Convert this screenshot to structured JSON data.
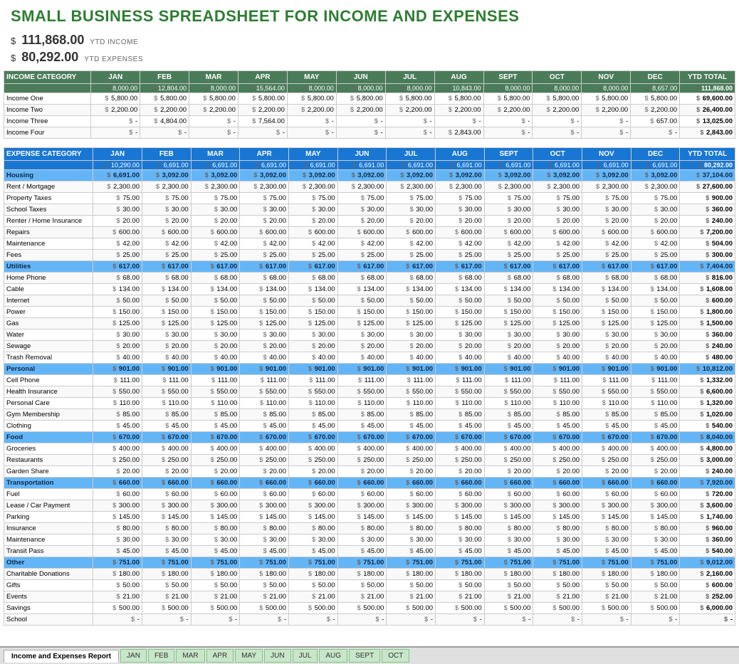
{
  "title": "SMALL BUSINESS SPREADSHEET FOR INCOME AND EXPENSES",
  "ytd_income_label": "YTD INCOME",
  "ytd_income_value": "111,868.00",
  "ytd_expenses_label": "YTD EXPENSES",
  "ytd_expenses_value": "80,292.00",
  "income_table": {
    "category_header": "INCOME CATEGORY",
    "columns": [
      "JAN",
      "FEB",
      "MAR",
      "APR",
      "MAY",
      "JUN",
      "JUL",
      "AUG",
      "SEPT",
      "OCT",
      "NOV",
      "DEC",
      "YTD TOTAL"
    ],
    "totals_row": [
      "8,000.00",
      "12,804.00",
      "8,000.00",
      "15,564.00",
      "8,000.00",
      "8,000.00",
      "8,000.00",
      "10,843.00",
      "8,000.00",
      "8,000.00",
      "8,000.00",
      "8,657.00",
      "111,868.00"
    ],
    "rows": [
      {
        "name": "Income One",
        "values": [
          "5,800.00",
          "5,800.00",
          "5,800.00",
          "5,800.00",
          "5,800.00",
          "5,800.00",
          "5,800.00",
          "5,800.00",
          "5,800.00",
          "5,800.00",
          "5,800.00",
          "5,800.00",
          "69,600.00"
        ]
      },
      {
        "name": "Income Two",
        "values": [
          "2,200.00",
          "2,200.00",
          "2,200.00",
          "2,200.00",
          "2,200.00",
          "2,200.00",
          "2,200.00",
          "2,200.00",
          "2,200.00",
          "2,200.00",
          "2,200.00",
          "2,200.00",
          "26,400.00"
        ]
      },
      {
        "name": "Income Three",
        "values": [
          "-",
          "4,804.00",
          "-",
          "7,564.00",
          "-",
          "-",
          "-",
          "-",
          "-",
          "-",
          "-",
          "657.00",
          "13,025.00"
        ]
      },
      {
        "name": "Income Four",
        "values": [
          "-",
          "-",
          "-",
          "-",
          "-",
          "-",
          "-",
          "2,843.00",
          "-",
          "-",
          "-",
          "-",
          "2,843.00"
        ]
      }
    ]
  },
  "expense_table": {
    "category_header": "EXPENSE CATEGORY",
    "columns": [
      "JAN",
      "FEB",
      "MAR",
      "APR",
      "MAY",
      "JUN",
      "JUL",
      "AUG",
      "SEPT",
      "OCT",
      "NOV",
      "DEC",
      "YTD TOTAL"
    ],
    "totals_row": [
      "10,290.00",
      "6,691.00",
      "6,691.00",
      "6,691.00",
      "6,691.00",
      "6,691.00",
      "6,691.00",
      "6,691.00",
      "6,691.00",
      "6,691.00",
      "6,691.00",
      "6,691.00",
      "80,292.00"
    ],
    "sections": [
      {
        "name": "Housing",
        "total": [
          "6,691.00",
          "3,092.00",
          "3,092.00",
          "3,092.00",
          "3,092.00",
          "3,092.00",
          "3,092.00",
          "3,092.00",
          "3,092.00",
          "3,092.00",
          "3,092.00",
          "3,092.00",
          "37,104.00"
        ],
        "rows": [
          {
            "name": "Rent / Mortgage",
            "values": [
              "2,300.00",
              "2,300.00",
              "2,300.00",
              "2,300.00",
              "2,300.00",
              "2,300.00",
              "2,300.00",
              "2,300.00",
              "2,300.00",
              "2,300.00",
              "2,300.00",
              "2,300.00",
              "27,600.00"
            ]
          },
          {
            "name": "Property Taxes",
            "values": [
              "75.00",
              "75.00",
              "75.00",
              "75.00",
              "75.00",
              "75.00",
              "75.00",
              "75.00",
              "75.00",
              "75.00",
              "75.00",
              "75.00",
              "900.00"
            ]
          },
          {
            "name": "School Taxes",
            "values": [
              "30.00",
              "30.00",
              "30.00",
              "30.00",
              "30.00",
              "30.00",
              "30.00",
              "30.00",
              "30.00",
              "30.00",
              "30.00",
              "30.00",
              "360.00"
            ]
          },
          {
            "name": "Renter / Home Insurance",
            "values": [
              "20.00",
              "20.00",
              "20.00",
              "20.00",
              "20.00",
              "20.00",
              "20.00",
              "20.00",
              "20.00",
              "20.00",
              "20.00",
              "20.00",
              "240.00"
            ]
          },
          {
            "name": "Repairs",
            "values": [
              "600.00",
              "600.00",
              "600.00",
              "600.00",
              "600.00",
              "600.00",
              "600.00",
              "600.00",
              "600.00",
              "600.00",
              "600.00",
              "600.00",
              "7,200.00"
            ]
          },
          {
            "name": "Maintenance",
            "values": [
              "42.00",
              "42.00",
              "42.00",
              "42.00",
              "42.00",
              "42.00",
              "42.00",
              "42.00",
              "42.00",
              "42.00",
              "42.00",
              "42.00",
              "504.00"
            ]
          },
          {
            "name": "Fees",
            "values": [
              "25.00",
              "25.00",
              "25.00",
              "25.00",
              "25.00",
              "25.00",
              "25.00",
              "25.00",
              "25.00",
              "25.00",
              "25.00",
              "25.00",
              "300.00"
            ]
          }
        ]
      },
      {
        "name": "Utilities",
        "total": [
          "617.00",
          "617.00",
          "617.00",
          "617.00",
          "617.00",
          "617.00",
          "617.00",
          "617.00",
          "617.00",
          "617.00",
          "617.00",
          "617.00",
          "7,404.00"
        ],
        "rows": [
          {
            "name": "Home Phone",
            "values": [
              "68.00",
              "68.00",
              "68.00",
              "68.00",
              "68.00",
              "68.00",
              "68.00",
              "68.00",
              "68.00",
              "68.00",
              "68.00",
              "68.00",
              "816.00"
            ]
          },
          {
            "name": "Cable",
            "values": [
              "134.00",
              "134.00",
              "134.00",
              "134.00",
              "134.00",
              "134.00",
              "134.00",
              "134.00",
              "134.00",
              "134.00",
              "134.00",
              "134.00",
              "1,608.00"
            ]
          },
          {
            "name": "Internet",
            "values": [
              "50.00",
              "50.00",
              "50.00",
              "50.00",
              "50.00",
              "50.00",
              "50.00",
              "50.00",
              "50.00",
              "50.00",
              "50.00",
              "50.00",
              "600.00"
            ]
          },
          {
            "name": "Power",
            "values": [
              "150.00",
              "150.00",
              "150.00",
              "150.00",
              "150.00",
              "150.00",
              "150.00",
              "150.00",
              "150.00",
              "150.00",
              "150.00",
              "150.00",
              "1,800.00"
            ]
          },
          {
            "name": "Gas",
            "values": [
              "125.00",
              "125.00",
              "125.00",
              "125.00",
              "125.00",
              "125.00",
              "125.00",
              "125.00",
              "125.00",
              "125.00",
              "125.00",
              "125.00",
              "1,500.00"
            ]
          },
          {
            "name": "Water",
            "values": [
              "30.00",
              "30.00",
              "30.00",
              "30.00",
              "30.00",
              "30.00",
              "30.00",
              "30.00",
              "30.00",
              "30.00",
              "30.00",
              "30.00",
              "360.00"
            ]
          },
          {
            "name": "Sewage",
            "values": [
              "20.00",
              "20.00",
              "20.00",
              "20.00",
              "20.00",
              "20.00",
              "20.00",
              "20.00",
              "20.00",
              "20.00",
              "20.00",
              "20.00",
              "240.00"
            ]
          },
          {
            "name": "Trash Removal",
            "values": [
              "40.00",
              "40.00",
              "40.00",
              "40.00",
              "40.00",
              "40.00",
              "40.00",
              "40.00",
              "40.00",
              "40.00",
              "40.00",
              "40.00",
              "480.00"
            ]
          }
        ]
      },
      {
        "name": "Personal",
        "total": [
          "901.00",
          "901.00",
          "901.00",
          "901.00",
          "901.00",
          "901.00",
          "901.00",
          "901.00",
          "901.00",
          "901.00",
          "901.00",
          "901.00",
          "10,812.00"
        ],
        "rows": [
          {
            "name": "Cell Phone",
            "values": [
              "111.00",
              "111.00",
              "111.00",
              "111.00",
              "111.00",
              "111.00",
              "111.00",
              "111.00",
              "111.00",
              "111.00",
              "111.00",
              "111.00",
              "1,332.00"
            ]
          },
          {
            "name": "Health Insurance",
            "values": [
              "550.00",
              "550.00",
              "550.00",
              "550.00",
              "550.00",
              "550.00",
              "550.00",
              "550.00",
              "550.00",
              "550.00",
              "550.00",
              "550.00",
              "6,600.00"
            ]
          },
          {
            "name": "Personal Care",
            "values": [
              "110.00",
              "110.00",
              "110.00",
              "110.00",
              "110.00",
              "110.00",
              "110.00",
              "110.00",
              "110.00",
              "110.00",
              "110.00",
              "110.00",
              "1,320.00"
            ]
          },
          {
            "name": "Gym Membership",
            "values": [
              "85.00",
              "85.00",
              "85.00",
              "85.00",
              "85.00",
              "85.00",
              "85.00",
              "85.00",
              "85.00",
              "85.00",
              "85.00",
              "85.00",
              "1,020.00"
            ]
          },
          {
            "name": "Clothing",
            "values": [
              "45.00",
              "45.00",
              "45.00",
              "45.00",
              "45.00",
              "45.00",
              "45.00",
              "45.00",
              "45.00",
              "45.00",
              "45.00",
              "45.00",
              "540.00"
            ]
          }
        ]
      },
      {
        "name": "Food",
        "total": [
          "670.00",
          "670.00",
          "670.00",
          "670.00",
          "670.00",
          "670.00",
          "670.00",
          "670.00",
          "670.00",
          "670.00",
          "670.00",
          "670.00",
          "8,040.00"
        ],
        "rows": [
          {
            "name": "Groceries",
            "values": [
              "400.00",
              "400.00",
              "400.00",
              "400.00",
              "400.00",
              "400.00",
              "400.00",
              "400.00",
              "400.00",
              "400.00",
              "400.00",
              "400.00",
              "4,800.00"
            ]
          },
          {
            "name": "Restaurants",
            "values": [
              "250.00",
              "250.00",
              "250.00",
              "250.00",
              "250.00",
              "250.00",
              "250.00",
              "250.00",
              "250.00",
              "250.00",
              "250.00",
              "250.00",
              "3,000.00"
            ]
          },
          {
            "name": "Garden Share",
            "values": [
              "20.00",
              "20.00",
              "20.00",
              "20.00",
              "20.00",
              "20.00",
              "20.00",
              "20.00",
              "20.00",
              "20.00",
              "20.00",
              "20.00",
              "240.00"
            ]
          }
        ]
      },
      {
        "name": "Transportation",
        "total": [
          "660.00",
          "660.00",
          "660.00",
          "660.00",
          "660.00",
          "660.00",
          "660.00",
          "660.00",
          "660.00",
          "660.00",
          "660.00",
          "660.00",
          "7,920.00"
        ],
        "rows": [
          {
            "name": "Fuel",
            "values": [
              "60.00",
              "60.00",
              "60.00",
              "60.00",
              "60.00",
              "60.00",
              "60.00",
              "60.00",
              "60.00",
              "60.00",
              "60.00",
              "60.00",
              "720.00"
            ]
          },
          {
            "name": "Lease / Car Payment",
            "values": [
              "300.00",
              "300.00",
              "300.00",
              "300.00",
              "300.00",
              "300.00",
              "300.00",
              "300.00",
              "300.00",
              "300.00",
              "300.00",
              "300.00",
              "3,600.00"
            ]
          },
          {
            "name": "Parking",
            "values": [
              "145.00",
              "145.00",
              "145.00",
              "145.00",
              "145.00",
              "145.00",
              "145.00",
              "145.00",
              "145.00",
              "145.00",
              "145.00",
              "145.00",
              "1,740.00"
            ]
          },
          {
            "name": "Insurance",
            "values": [
              "80.00",
              "80.00",
              "80.00",
              "80.00",
              "80.00",
              "80.00",
              "80.00",
              "80.00",
              "80.00",
              "80.00",
              "80.00",
              "80.00",
              "960.00"
            ]
          },
          {
            "name": "Maintenance",
            "values": [
              "30.00",
              "30.00",
              "30.00",
              "30.00",
              "30.00",
              "30.00",
              "30.00",
              "30.00",
              "30.00",
              "30.00",
              "30.00",
              "30.00",
              "360.00"
            ]
          },
          {
            "name": "Transit Pass",
            "values": [
              "45.00",
              "45.00",
              "45.00",
              "45.00",
              "45.00",
              "45.00",
              "45.00",
              "45.00",
              "45.00",
              "45.00",
              "45.00",
              "45.00",
              "540.00"
            ]
          }
        ]
      },
      {
        "name": "Other",
        "total": [
          "751.00",
          "751.00",
          "751.00",
          "751.00",
          "751.00",
          "751.00",
          "751.00",
          "751.00",
          "751.00",
          "751.00",
          "751.00",
          "751.00",
          "9,012.00"
        ],
        "rows": [
          {
            "name": "Charitable Donations",
            "values": [
              "180.00",
              "180.00",
              "180.00",
              "180.00",
              "180.00",
              "180.00",
              "180.00",
              "180.00",
              "180.00",
              "180.00",
              "180.00",
              "180.00",
              "2,160.00"
            ]
          },
          {
            "name": "Gifts",
            "values": [
              "50.00",
              "50.00",
              "50.00",
              "50.00",
              "50.00",
              "50.00",
              "50.00",
              "50.00",
              "50.00",
              "50.00",
              "50.00",
              "50.00",
              "600.00"
            ]
          },
          {
            "name": "Events",
            "values": [
              "21.00",
              "21.00",
              "21.00",
              "21.00",
              "21.00",
              "21.00",
              "21.00",
              "21.00",
              "21.00",
              "21.00",
              "21.00",
              "21.00",
              "252.00"
            ]
          },
          {
            "name": "Savings",
            "values": [
              "500.00",
              "500.00",
              "500.00",
              "500.00",
              "500.00",
              "500.00",
              "500.00",
              "500.00",
              "500.00",
              "500.00",
              "500.00",
              "500.00",
              "6,000.00"
            ]
          },
          {
            "name": "School",
            "values": [
              "-",
              "-",
              "-",
              "-",
              "-",
              "-",
              "-",
              "-",
              "-",
              "-",
              "-",
              "-",
              "-"
            ]
          }
        ]
      }
    ]
  },
  "tabs": {
    "active": "Income and Expenses Report",
    "months": [
      "JAN",
      "FEB",
      "MAR",
      "APR",
      "MAY",
      "JUN",
      "JUL",
      "AUG",
      "SEPT",
      "OCT"
    ]
  }
}
